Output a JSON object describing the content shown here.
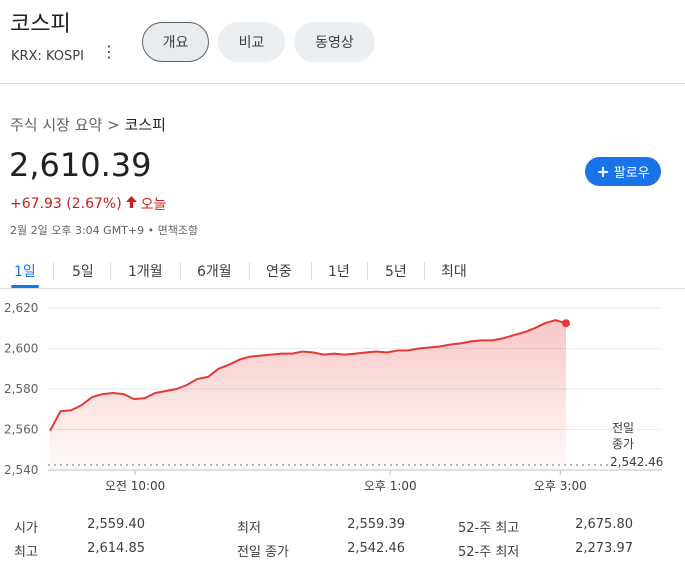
{
  "header": {
    "title": "코스피",
    "ticker": "KRX: KOSPI",
    "tabs": [
      "개요",
      "비교",
      "동영상"
    ]
  },
  "breadcrumb": {
    "parent": "주식 시장 요약",
    "separator": ">",
    "current": "코스피"
  },
  "quote": {
    "price": "2,610.39",
    "change": "+67.93 (2.67%)",
    "period": "오늘",
    "timestamp": "2월 2일 오후 3:04 GMT+9 • 면책조항"
  },
  "follow_label": "팔로우",
  "range_tabs": [
    "1일",
    "5일",
    "1개월",
    "6개월",
    "연중",
    "1년",
    "5년",
    "최대"
  ],
  "selected_range": "1일",
  "colors": {
    "line": "#e53935",
    "accent": "#1a73e8",
    "down": "#c5221f"
  },
  "chart_data": {
    "type": "area",
    "x": [
      "09:00",
      "09:08",
      "09:15",
      "09:23",
      "09:30",
      "09:38",
      "09:45",
      "09:53",
      "10:00",
      "10:08",
      "10:15",
      "10:23",
      "10:30",
      "10:38",
      "10:45",
      "10:53",
      "11:00",
      "11:08",
      "11:15",
      "11:23",
      "11:30",
      "11:38",
      "11:45",
      "11:53",
      "12:00",
      "12:08",
      "12:15",
      "12:23",
      "12:30",
      "12:38",
      "12:45",
      "12:53",
      "13:00",
      "13:08",
      "13:15",
      "13:23",
      "13:30",
      "13:38",
      "13:45",
      "13:53",
      "14:00",
      "14:08",
      "14:15",
      "14:23",
      "14:30",
      "14:38",
      "14:45",
      "14:53",
      "15:00",
      "15:04"
    ],
    "values": [
      2559.4,
      2569.0,
      2569.5,
      2572.0,
      2576.0,
      2577.5,
      2578.0,
      2577.5,
      2575.0,
      2575.5,
      2578.0,
      2579.0,
      2580.0,
      2582.0,
      2585.0,
      2586.0,
      2590.0,
      2592.0,
      2594.5,
      2596.0,
      2596.5,
      2597.0,
      2597.5,
      2597.5,
      2598.5,
      2598.0,
      2597.0,
      2597.5,
      2597.0,
      2597.5,
      2598.0,
      2598.5,
      2598.0,
      2599.0,
      2599.0,
      2600.0,
      2600.5,
      2601.0,
      2602.0,
      2602.5,
      2603.5,
      2604.0,
      2604.0,
      2605.0,
      2606.5,
      2608.0,
      2610.0,
      2612.5,
      2614.0,
      2612.5
    ],
    "ylim": [
      2540,
      2620
    ],
    "yticks": [
      "2,620",
      "2,600",
      "2,580",
      "2,560",
      "2,540"
    ],
    "xticks": [
      "오전 10:00",
      "오후 1:00",
      "오후 3:00"
    ],
    "previous_close": {
      "label": "전일 종가",
      "value": "2,542.46"
    }
  },
  "stats": [
    {
      "label": "시가",
      "value": "2,559.40"
    },
    {
      "label": "최저",
      "value": "2,559.39"
    },
    {
      "label": "52-주 최고",
      "value": "2,675.80"
    },
    {
      "label": "최고",
      "value": "2,614.85"
    },
    {
      "label": "전일 종가",
      "value": "2,542.46"
    },
    {
      "label": "52-주 최저",
      "value": "2,273.97"
    }
  ]
}
